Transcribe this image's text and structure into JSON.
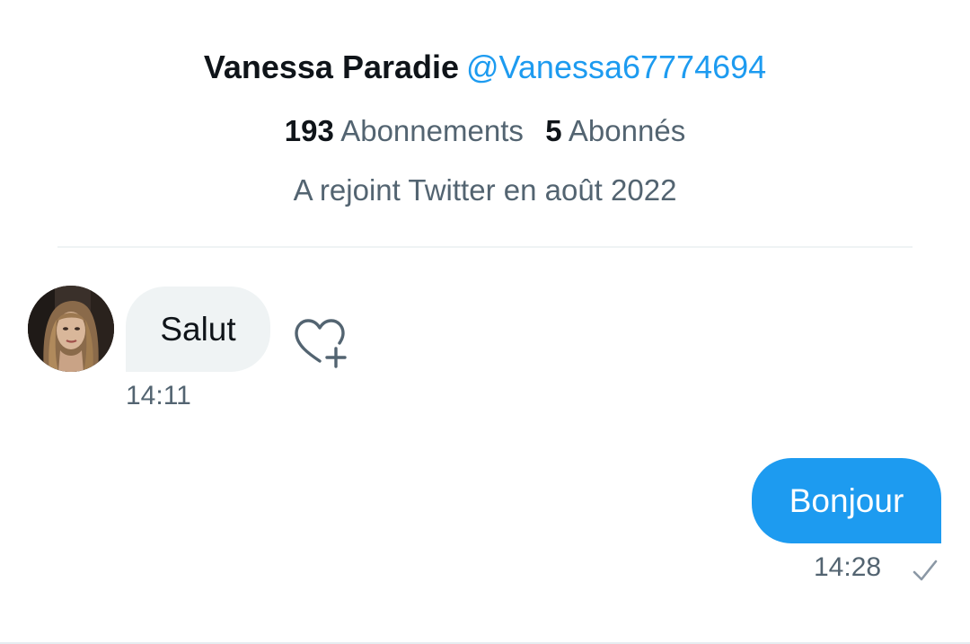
{
  "profile": {
    "display_name": "Vanessa Paradie",
    "handle": "@Vanessa67774694",
    "following_count": "193",
    "following_label": "Abonnements",
    "followers_count": "5",
    "followers_label": "Abonnés",
    "joined": "A rejoint Twitter en août 2022"
  },
  "messages": [
    {
      "direction": "incoming",
      "text": "Salut",
      "time": "14:11"
    },
    {
      "direction": "outgoing",
      "text": "Bonjour",
      "time": "14:28",
      "status_icon": "check-icon"
    }
  ],
  "icons": {
    "react": "heart-plus-icon",
    "status": "check-icon"
  },
  "colors": {
    "accent": "#1d9bf0",
    "text_primary": "#0f1419",
    "text_secondary": "#536471",
    "bubble_incoming": "#eff3f4"
  }
}
